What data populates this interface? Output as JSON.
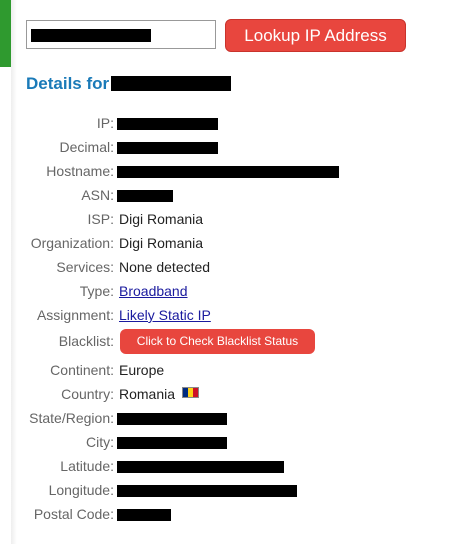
{
  "search": {
    "button_label": "Lookup IP Address"
  },
  "details": {
    "title": "Details for"
  },
  "rows": [
    {
      "label": "IP:",
      "value": "",
      "redacted": true
    },
    {
      "label": "Decimal:",
      "value": "",
      "redacted": true
    },
    {
      "label": "Hostname:",
      "value": "",
      "redacted": true
    },
    {
      "label": "ASN:",
      "value": "",
      "redacted": true
    },
    {
      "label": "ISP:",
      "value": "Digi Romania"
    },
    {
      "label": "Organization:",
      "value": "Digi Romania"
    },
    {
      "label": "Services:",
      "value": "None detected"
    },
    {
      "label": "Type:",
      "value": "Broadband",
      "link": true
    },
    {
      "label": "Assignment:",
      "value": "Likely Static IP",
      "link": true
    },
    {
      "label": "Blacklist:",
      "button_label": "Click to Check Blacklist Status"
    },
    {
      "label": "Continent:",
      "value": "Europe"
    },
    {
      "label": "Country:",
      "value": "Romania",
      "icon": "flag-romania-icon"
    },
    {
      "label": "State/Region:",
      "value": "",
      "redacted": true
    },
    {
      "label": "City:",
      "value": "",
      "redacted": true
    },
    {
      "label": "Latitude:",
      "value": "",
      "redacted": true
    },
    {
      "label": "Longitude:",
      "value": "",
      "redacted": true
    },
    {
      "label": "Postal Code:",
      "value": "",
      "redacted": true
    }
  ],
  "colors": {
    "accent_red": "#e8463e",
    "title_blue": "#1a7ab8",
    "link_blue": "#1a1a9e",
    "side_green": "#2f9a2f",
    "flag_romania": [
      "#002b7f",
      "#fcd116",
      "#ce1126"
    ]
  }
}
